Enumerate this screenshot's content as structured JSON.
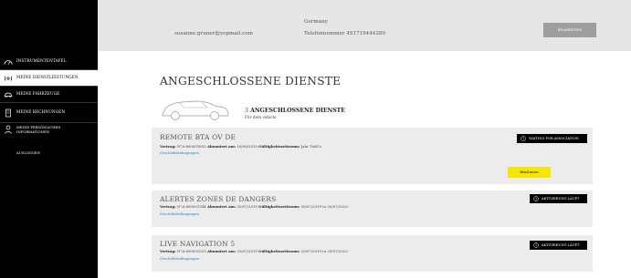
{
  "sidebar": {
    "items": [
      {
        "label": "INSTRUMENTENTAFEL",
        "icon": "gauge-icon"
      },
      {
        "label": "MEINE DIENSTLEISTUNGEN",
        "icon": "connected-icon"
      },
      {
        "label": "MEINE FAHRZEUGE",
        "icon": "car-icon"
      },
      {
        "label": "MEINE RECHNUNGEN",
        "icon": "invoice-icon"
      },
      {
        "label": "MEINE PERSÖNLICHEN INFORMATIONEN",
        "icon": "user-icon"
      },
      {
        "label": "AUSLOGGEN",
        "icon": ""
      }
    ]
  },
  "header": {
    "email": "susanne.gruner@yopmail.com",
    "country": "Germany",
    "phone": "Telefonnummer 491719444280",
    "edit_button": "BEARBEITEN"
  },
  "main": {
    "title": "ANGESCHLOSSENE DIENSTE",
    "count_number": "3",
    "count_label": "ANGESCHLOSSENE DIENSTE",
    "count_sub": "Für dein vehicle",
    "services": [
      {
        "name": "REMOTE BTA OV DE",
        "meta": {
          "vertrag_label": "Vertrag:",
          "vertrag": "N°A-800001610",
          "abonniert_label": "Abonniert am:",
          "abonniert": "16/08/2019",
          "gueltig_label": "Gültigkeitszeitraum:",
          "gueltig": "Jahr TuKCs"
        },
        "link": "Geschäftsbedingungen",
        "status": "WAITING FOR ASSOCIATION",
        "read_more": "Read more"
      },
      {
        "name": "ALERTES ZONES DE DANGERS",
        "meta": {
          "vertrag_label": "Vertrag:",
          "vertrag": "N°A-800001344",
          "abonniert_label": "Abonniert am:",
          "abonniert": "30/07/2019",
          "gueltig_label": "Gültigkeitszeitraum:",
          "gueltig": "30/07/2019 to 30/07/2020"
        },
        "link": "Geschäftsbedingungen",
        "status": "AKTIVIERUNG LÄUFT"
      },
      {
        "name": "LIVE NAVIGATION 5",
        "meta": {
          "vertrag_label": "Vertrag:",
          "vertrag": "N°A-800001325",
          "abonniert_label": "Abonniert am:",
          "abonniert": "29/07/2019",
          "gueltig_label": "Gültigkeitszeitraum:",
          "gueltig": "29/07/2019 to 29/07/2022"
        },
        "link": "Geschäftsbedingungen",
        "status": "AKTIVIERUNG LÄUFT"
      }
    ]
  },
  "colors": {
    "sidebar_bg": "#000000",
    "header_bg": "#e6e6e6",
    "card_bg": "#ececec",
    "accent_yellow": "#f6e600",
    "link_blue": "#2a7fc9"
  }
}
